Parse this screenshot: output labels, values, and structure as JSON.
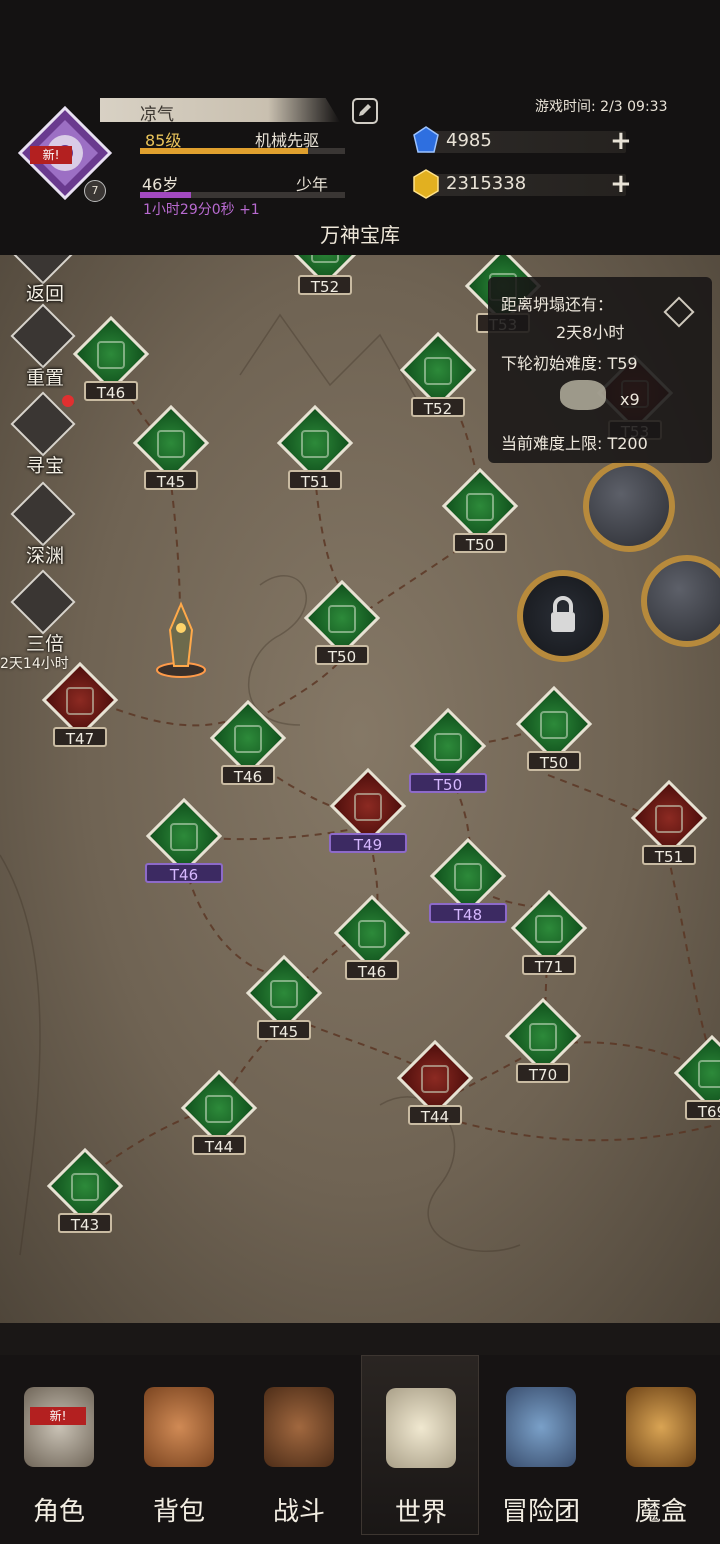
{
  "header": {
    "player_name": "凉气",
    "level": "85级",
    "class_name": "机械先驱",
    "level_progress": 0.82,
    "age": "46岁",
    "life_stage": "少年",
    "age_progress": 0.25,
    "timer": "1小时29分0秒 +1",
    "game_time": "游戏时间: 2/3 09:33",
    "avatar_badge": "新!",
    "avatar_rank": "7",
    "gems": "4985",
    "gold": "2315338",
    "page_title": "万神宝库"
  },
  "side_buttons": [
    {
      "label": "返回",
      "icon": "back-icon"
    },
    {
      "label": "重置",
      "icon": "reset-icon"
    },
    {
      "label": "寻宝",
      "icon": "treasure-skull-icon"
    },
    {
      "label": "深渊",
      "icon": "abyss-icon"
    },
    {
      "label": "三倍",
      "icon": "arrow-up-icon"
    }
  ],
  "triple_timer": "2天14小时",
  "collapse_panel": {
    "countdown_label": "距离坍塌还有：",
    "countdown_value": "2天8小时",
    "next_difficulty": "下轮初始难度: T59",
    "reward_count": "x9",
    "difficulty_cap": "当前难度上限: T200"
  },
  "map_nodes": [
    {
      "label": "T52",
      "kind": "green"
    },
    {
      "label": "T53",
      "kind": "green"
    },
    {
      "label": "T46",
      "kind": "green"
    },
    {
      "label": "T52",
      "kind": "green"
    },
    {
      "label": "T53",
      "kind": "red"
    },
    {
      "label": "T45",
      "kind": "green"
    },
    {
      "label": "T51",
      "kind": "green"
    },
    {
      "label": "T50",
      "kind": "green"
    },
    {
      "label": "T50",
      "kind": "green"
    },
    {
      "label": "T47",
      "kind": "red"
    },
    {
      "label": "T46",
      "kind": "green"
    },
    {
      "label": "T50",
      "kind": "green-elite"
    },
    {
      "label": "T50",
      "kind": "green"
    },
    {
      "label": "T49",
      "kind": "red-elite"
    },
    {
      "label": "T51",
      "kind": "red"
    },
    {
      "label": "T46",
      "kind": "green-elite"
    },
    {
      "label": "T48",
      "kind": "green-elite"
    },
    {
      "label": "T46",
      "kind": "green"
    },
    {
      "label": "T71",
      "kind": "green"
    },
    {
      "label": "T45",
      "kind": "green"
    },
    {
      "label": "T70",
      "kind": "green"
    },
    {
      "label": "T44",
      "kind": "red"
    },
    {
      "label": "T69",
      "kind": "green"
    },
    {
      "label": "T44",
      "kind": "green"
    },
    {
      "label": "T43",
      "kind": "green"
    }
  ],
  "nav": [
    {
      "label": "角色",
      "icon": "helmet-icon",
      "badge": "新!"
    },
    {
      "label": "背包",
      "icon": "backpack-icon"
    },
    {
      "label": "战斗",
      "icon": "sword-shield-icon"
    },
    {
      "label": "世界",
      "icon": "scroll-icon",
      "active": true
    },
    {
      "label": "冒险团",
      "icon": "castle-icon"
    },
    {
      "label": "魔盒",
      "icon": "magic-box-icon"
    }
  ]
}
